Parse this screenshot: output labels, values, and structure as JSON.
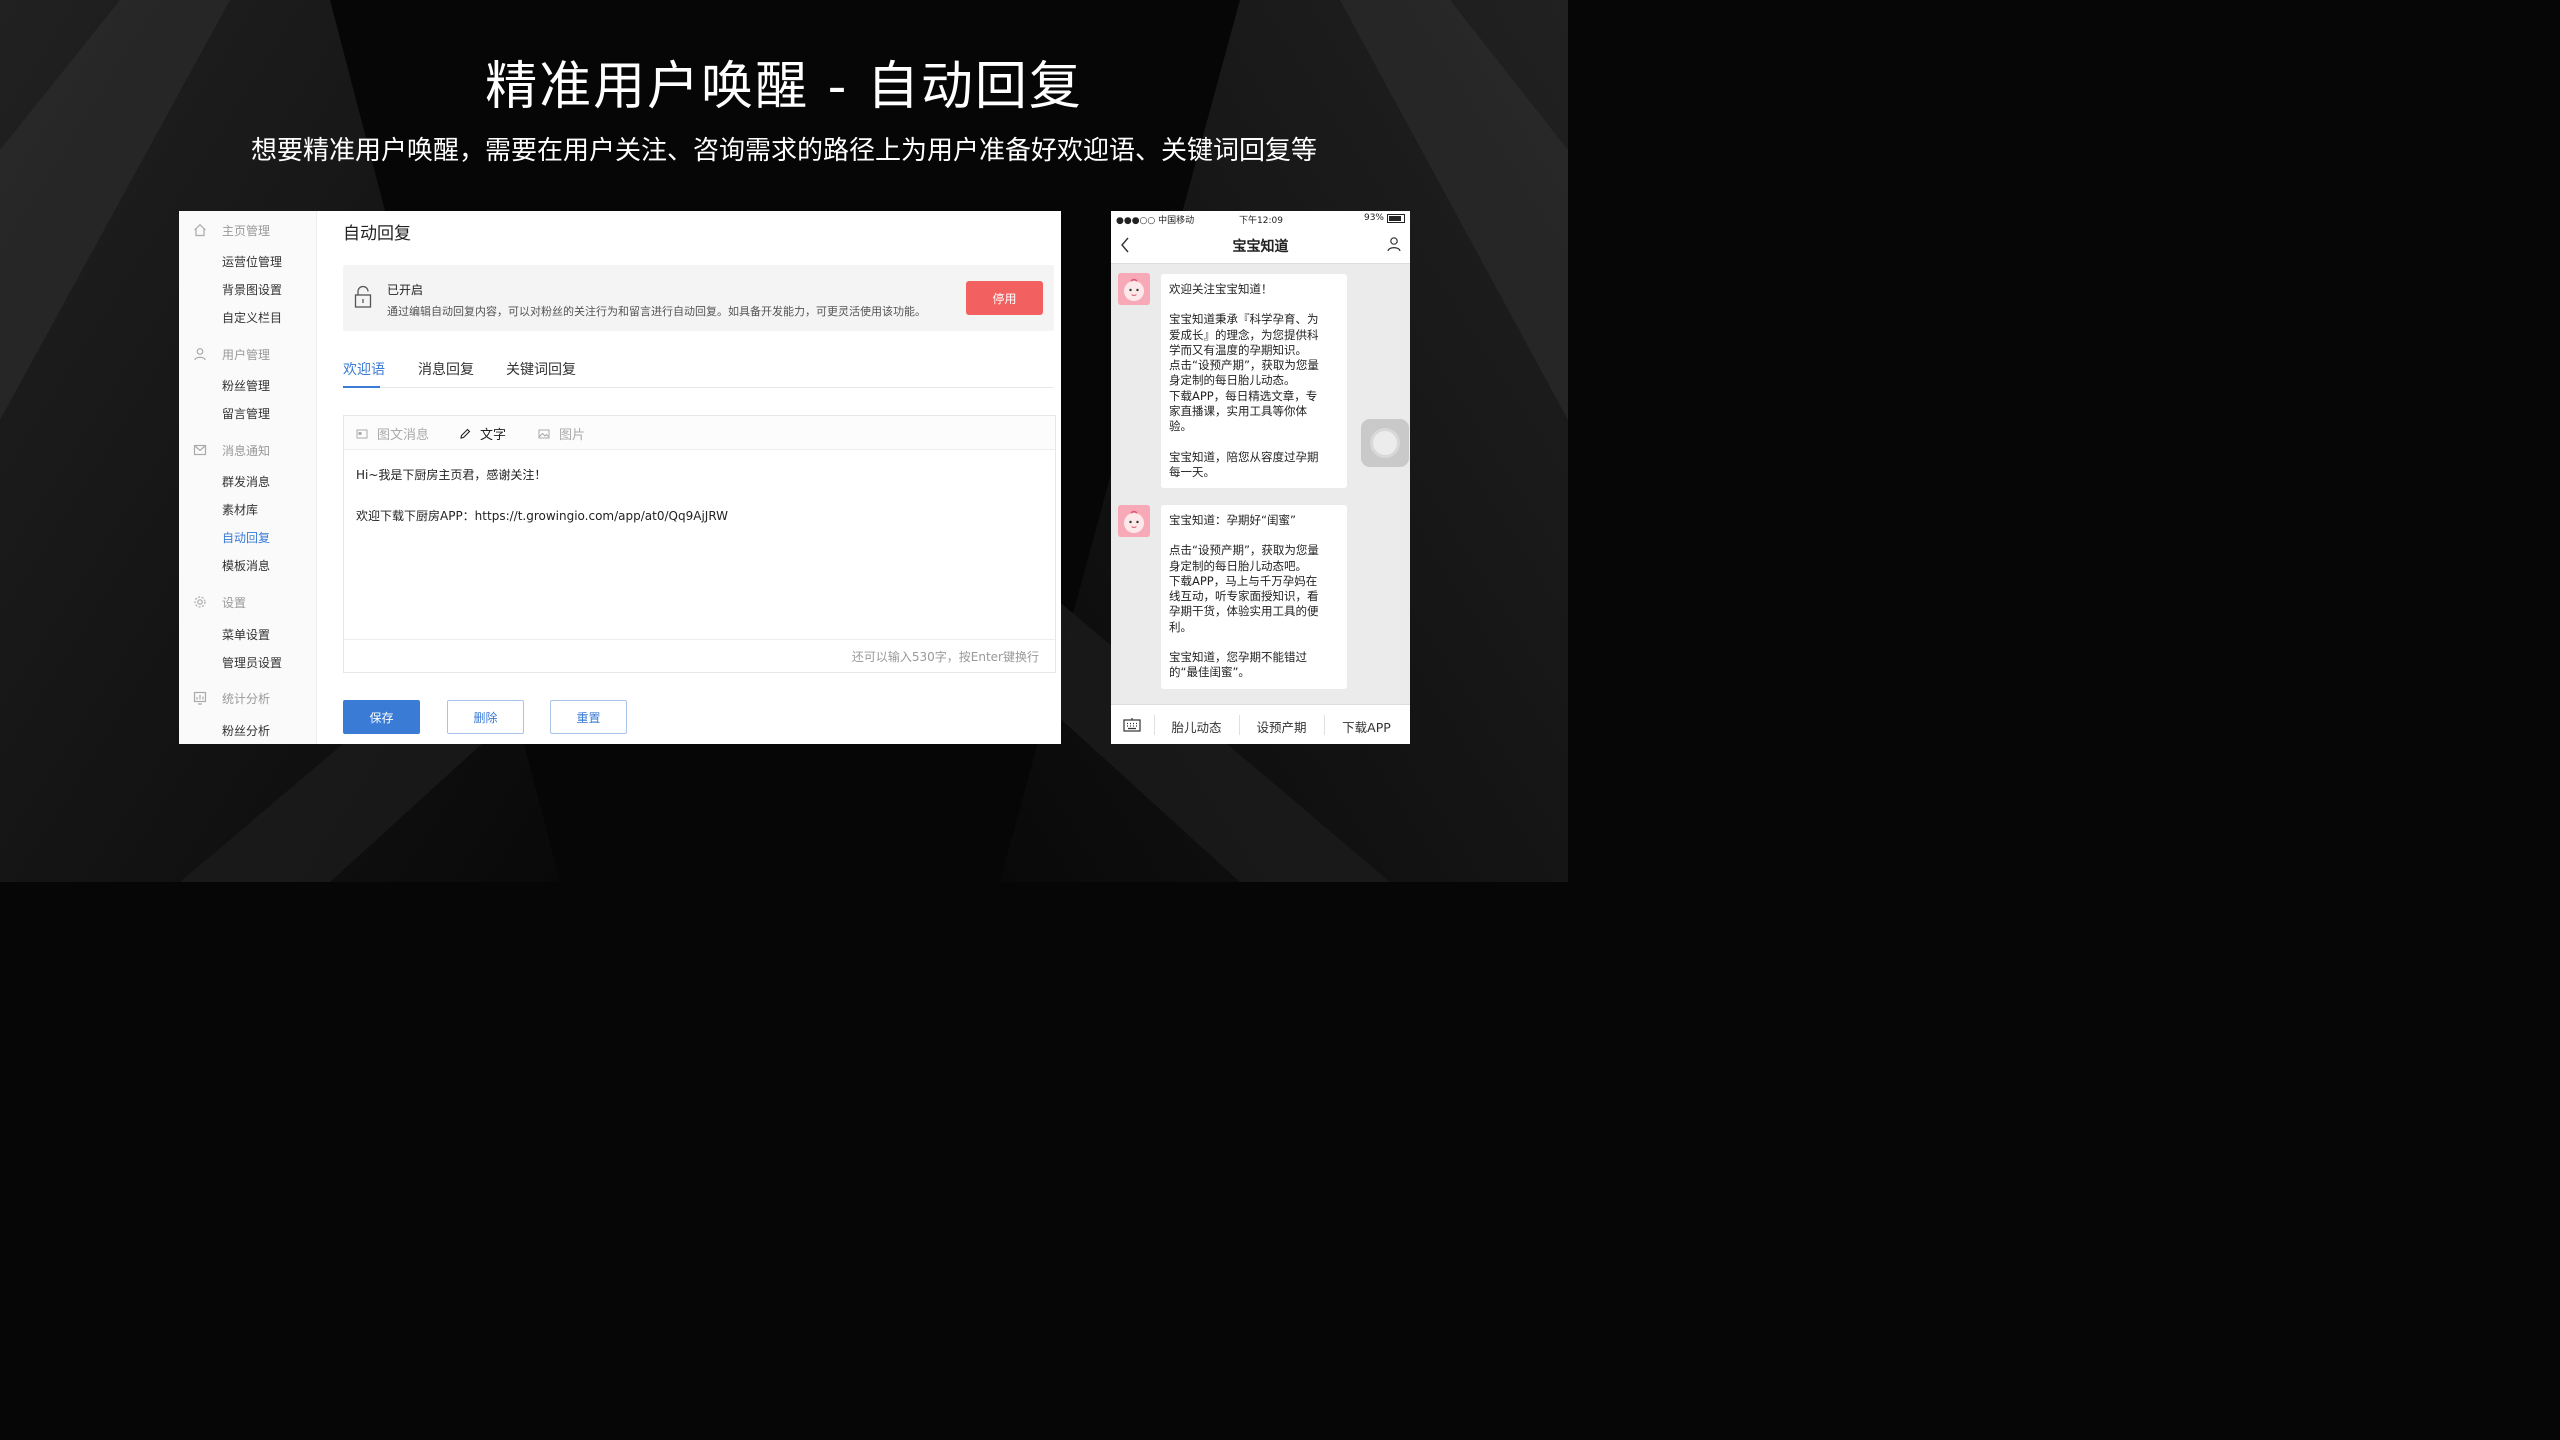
{
  "slide": {
    "title": "精准用户唤醒 - 自动回复",
    "subtitle": "想要精准用户唤醒，需要在用户关注、咨询需求的路径上为用户准备好欢迎语、关键词回复等"
  },
  "admin": {
    "sidebar": {
      "groups": [
        {
          "label": "主页管理",
          "icon": "home-icon",
          "items": [
            "运营位管理",
            "背景图设置",
            "自定义栏目"
          ]
        },
        {
          "label": "用户管理",
          "icon": "user-icon",
          "items": [
            "粉丝管理",
            "留言管理"
          ]
        },
        {
          "label": "消息通知",
          "icon": "message-icon",
          "items": [
            "群发消息",
            "素材库",
            "自动回复",
            "模板消息"
          ]
        },
        {
          "label": "设置",
          "icon": "gear-icon",
          "items": [
            "菜单设置",
            "管理员设置"
          ]
        },
        {
          "label": "统计分析",
          "icon": "chart-icon",
          "items": [
            "粉丝分析"
          ]
        }
      ],
      "active_item": "自动回复"
    },
    "page_title": "自动回复",
    "status": {
      "label": "已开启",
      "description": "通过编辑自动回复内容，可以对粉丝的关注行为和留言进行自动回复。如具备开发能力，可更灵活使用该功能。",
      "disable_button": "停用"
    },
    "tabs": [
      "欢迎语",
      "消息回复",
      "关键词回复"
    ],
    "active_tab": "欢迎语",
    "editor": {
      "tools": [
        "图文消息",
        "文字",
        "图片"
      ],
      "active_tool": "文字",
      "lines": [
        "Hi~我是下厨房主页君，感谢关注！",
        "欢迎下载下厨房APP：https://t.growingio.com/app/at0/Qq9AjJRW"
      ],
      "counter": "还可以输入530字，按Enter键换行"
    },
    "buttons": {
      "save": "保存",
      "delete": "删除",
      "reset": "重置"
    },
    "colors": {
      "accent": "#3a7bd5",
      "danger": "#f26060"
    }
  },
  "phone": {
    "status_bar": {
      "carrier": "●●●○○ 中国移动",
      "time": "下午12:09",
      "battery": "93%"
    },
    "nav_title": "宝宝知道",
    "messages": [
      {
        "paragraphs": [
          [
            "欢迎关注宝宝知道！"
          ],
          [
            "宝宝知道秉承『科学孕育、为",
            "爱成长』的理念，为您提供科",
            "学而又有温度的孕期知识。",
            "点击“设预产期”，获取为您量",
            "身定制的每日胎儿动态。",
            "下载APP，每日精选文章，专",
            "家直播课，实用工具等你体",
            "验。"
          ],
          [
            "宝宝知道，陪您从容度过孕期",
            "每一天。"
          ]
        ]
      },
      {
        "paragraphs": [
          [
            "宝宝知道：孕期好“闺蜜”"
          ],
          [
            "点击“设预产期”，获取为您量",
            "身定制的每日胎儿动态吧。",
            "下载APP，马上与千万孕妈在",
            "线互动，听专家面授知识，看",
            "孕期干货，体验实用工具的便",
            "利。"
          ],
          [
            "宝宝知道，您孕期不能错过",
            "的“最佳闺蜜”。"
          ]
        ]
      }
    ],
    "menu": [
      "胎儿动态",
      "设预产期",
      "下载APP"
    ]
  }
}
